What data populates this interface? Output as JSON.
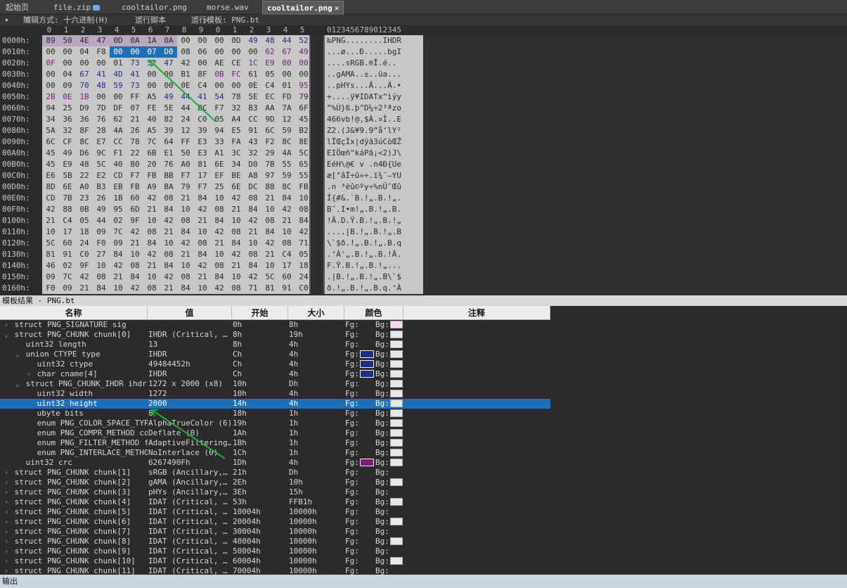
{
  "tabs": [
    {
      "label": "起始页"
    },
    {
      "label": "file.zip"
    },
    {
      "label": "cooltailor.png"
    },
    {
      "label": "morse.wav"
    },
    {
      "label": "cooltailor.png",
      "active": true
    }
  ],
  "toolbar": {
    "edit_mode": "编辑方式: 十六进制(H)",
    "run_script": "运行脚本",
    "run_template": "运行模板: PNG.bt"
  },
  "hex": {
    "col_headers": [
      "0",
      "1",
      "2",
      "3",
      "4",
      "5",
      "6",
      "7",
      "8",
      "9",
      "0",
      "1",
      "2",
      "3",
      "4",
      "5"
    ],
    "ascii_header": "0123456789012345",
    "offsets": [
      "0000h:",
      "0010h:",
      "0020h:",
      "0030h:",
      "0040h:",
      "0050h:",
      "0060h:",
      "0070h:",
      "0080h:",
      "0090h:",
      "00A0h:",
      "00B0h:",
      "00C0h:",
      "00D0h:",
      "00E0h:",
      "00F0h:",
      "0100h:",
      "0110h:",
      "0120h:",
      "0130h:",
      "0140h:",
      "0150h:",
      "0160h:"
    ],
    "rows": [
      "89 50 4E 47 0D 0A 1A 0A 00 00 00 0D 49 48 44 52",
      "00 00 04 F8 00 00 07 D0 08 06 00 00 00 62 67 49",
      "0F 00 00 00 01 73 52 47 42 00 AE CE 1C E9 00 00",
      "00 04 67 41 4D 41 00 00 B1 8F 0B FC 61 05 00 00",
      "00 09 70 48 59 73 00 00 0E C4 00 00 0E C4 01 95",
      "2B 0E 1B 00 00 FF A5 49 44 41 54 78 5E EC FD 79",
      "94 25 D9 7D DF 07 FE 5E 44 BC F7 32 B3 AA 7A 6F",
      "34 36 36 76 62 21 40 82 24 C0 05 A4 CC 9D 12 45",
      "5A 32 8F 28 4A 26 A5 39 12 39 94 E5 91 6C 59 B2",
      "6C CF 8C E7 CC 78 7C 64 FF E3 33 FA 43 F2 8C 8E",
      "45 49 D6 9C F1 22 6B E1 50 E3 A1 3C 32 29 4A 5C",
      "45 E9 48 5C 40 80 20 76 A0 81 6E 34 D0 7B 55 65",
      "E6 5B 22 E2 CD F7 FB BB F7 17 EF BE A8 97 59 55",
      "8D 6E A0 B3 EB FB A9 BA 79 F7 25 6E DC 88 8C FB",
      "CD 7B 23 26 1B 60 42 08 21 84 10 42 08 21 84 10",
      "42 88 0B 49 95 6D 21 84 10 42 08 21 84 10 42 08",
      "21 C4 05 44 02 9F 10 42 08 21 84 10 42 08 21 84",
      "10 17 18 09 7C 42 08 21 84 10 42 08 21 84 10 42",
      "5C 60 24 F0 09 21 84 10 42 08 21 84 10 42 08 71",
      "81 91 C0 27 84 10 42 08 21 84 10 42 08 21 C4 05",
      "46 02 9F 10 42 08 21 84 10 42 08 21 84 10 17 18",
      "09 7C 42 08 21 84 10 42 08 21 84 10 42 5C 60 24",
      "F0 09 21 84 10 42 08 21 84 10 42 08 71 81 91 C0"
    ],
    "ascii": [
      "‰PNG........IHDR",
      "...ø...Ð.....bgI",
      "....sRGB.®Î.é..",
      "..gAMA..±..üa...",
      "..pHYs...Ä...Ä.•",
      "+....ÿ¥IDATx^ìýy",
      "”%Ù}ß.þ^D¼÷2³ªzo",
      "466vb!@‚$À.¤Ì..E",
      "Z2.(J&¥9.9”å‘lY²",
      "lÏŒçÌx|dÿã3úCòŒŽ",
      "EIÖœñ\"káPã¡<2)J\\",
      "EéH\\@€ v .n4Ð{Ue",
      "æ[\"âÍ÷û»÷.ï¾¨—YU",
      ".n ³ëû©ºy÷%nÜˆŒû",
      "Í{#&.`B.!„.B.!„.",
      "Bˆ.I•m!„.B.!„.B.",
      "!Ä.D.Ÿ.B.!„.B.!„",
      "....|B.!„.B.!„.B",
      "\\`$ð.!„.B.!„.B.q",
      ".‘À'„.B.!„.B.!Ä.",
      "F.Ÿ.B.!„.B.!„...",
      ".|B.!„.B.!„.B\\`$",
      "ð.!„.B.!„.B.q.‘À"
    ]
  },
  "results": {
    "header": "模板结果 - PNG.bt",
    "columns": [
      "名称",
      "值",
      "开始",
      "大小",
      "颜色",
      "注释"
    ],
    "fg_label": "Fg:",
    "bg_label": "Bg:",
    "rows": [
      {
        "exp": ">",
        "indent": 0,
        "name": "struct PNG_SIGNATURE sig",
        "value": "",
        "start": "0h",
        "size": "8h",
        "fg": "",
        "bg": "#ffd7f0"
      },
      {
        "exp": "v",
        "indent": 0,
        "name": "struct PNG_CHUNK chunk[0]",
        "value": "IHDR  (Critical, …",
        "start": "8h",
        "size": "19h",
        "fg": "",
        "bg": "#e8e8e8"
      },
      {
        "exp": "",
        "indent": 1,
        "name": "uint32 length",
        "value": "13",
        "start": "8h",
        "size": "4h",
        "fg": "",
        "bg": "#e8e8e8"
      },
      {
        "exp": "v",
        "indent": 1,
        "name": "union CTYPE type",
        "value": "IHDR",
        "start": "Ch",
        "size": "4h",
        "fg": "#1d2d8c",
        "bg": "#e8e8e8"
      },
      {
        "exp": "",
        "indent": 2,
        "name": "uint32 ctype",
        "value": "49484452h",
        "start": "Ch",
        "size": "4h",
        "fg": "#1d2d8c",
        "bg": "#e8e8e8"
      },
      {
        "exp": ">",
        "indent": 2,
        "name": "char cname[4]",
        "value": "IHDR",
        "start": "Ch",
        "size": "4h",
        "fg": "#1d2d8c",
        "bg": "#e8e8e8"
      },
      {
        "exp": "v",
        "indent": 1,
        "name": "struct PNG_CHUNK_IHDR ihdr",
        "value": "1272 x 2000 (x8)",
        "start": "10h",
        "size": "Dh",
        "fg": "",
        "bg": "#e8e8e8"
      },
      {
        "exp": "",
        "indent": 2,
        "name": "uint32 width",
        "value": "1272",
        "start": "10h",
        "size": "4h",
        "fg": "",
        "bg": "#e8e8e8"
      },
      {
        "exp": "",
        "indent": 2,
        "name": "uint32 height",
        "value": "2000",
        "start": "14h",
        "size": "4h",
        "fg": "",
        "bg": "#e8e8e8",
        "selected": true
      },
      {
        "exp": "",
        "indent": 2,
        "name": "ubyte bits",
        "value": "8",
        "start": "18h",
        "size": "1h",
        "fg": "",
        "bg": "#e8e8e8"
      },
      {
        "exp": "",
        "indent": 2,
        "name": "enum PNG_COLOR_SPACE_TYP…",
        "value": "AlphaTrueColor (6)",
        "start": "19h",
        "size": "1h",
        "fg": "",
        "bg": "#e8e8e8"
      },
      {
        "exp": "",
        "indent": 2,
        "name": "enum PNG_COMPR_METHOD co…",
        "value": "Deflate (0)",
        "start": "1Ah",
        "size": "1h",
        "fg": "",
        "bg": "#e8e8e8"
      },
      {
        "exp": "",
        "indent": 2,
        "name": "enum PNG_FILTER_METHOD f…",
        "value": "AdaptiveFiltering…",
        "start": "1Bh",
        "size": "1h",
        "fg": "",
        "bg": "#e8e8e8"
      },
      {
        "exp": "",
        "indent": 2,
        "name": "enum PNG_INTERLACE_METHO…",
        "value": "NoInterlace (0)",
        "start": "1Ch",
        "size": "1h",
        "fg": "",
        "bg": "#e8e8e8"
      },
      {
        "exp": "",
        "indent": 1,
        "name": "uint32 crc",
        "value": "6267490Fh",
        "start": "1Dh",
        "size": "4h",
        "fg": "#7a1a7a",
        "bg": "#e8e8e8"
      },
      {
        "exp": ">",
        "indent": 0,
        "name": "struct PNG_CHUNK chunk[1]",
        "value": "sRGB  (Ancillary,…",
        "start": "21h",
        "size": "Dh",
        "fg": "",
        "bg": ""
      },
      {
        "exp": ">",
        "indent": 0,
        "name": "struct PNG_CHUNK chunk[2]",
        "value": "gAMA  (Ancillary,…",
        "start": "2Eh",
        "size": "10h",
        "fg": "",
        "bg": "#e8e8e8"
      },
      {
        "exp": ">",
        "indent": 0,
        "name": "struct PNG_CHUNK chunk[3]",
        "value": "pHYs  (Ancillary,…",
        "start": "3Eh",
        "size": "15h",
        "fg": "",
        "bg": ""
      },
      {
        "exp": ">",
        "indent": 0,
        "name": "struct PNG_CHUNK chunk[4]",
        "value": "IDAT  (Critical, …",
        "start": "53h",
        "size": "FFB1h",
        "fg": "",
        "bg": "#e8e8e8"
      },
      {
        "exp": ">",
        "indent": 0,
        "name": "struct PNG_CHUNK chunk[5]",
        "value": "IDAT  (Critical, …",
        "start": "10004h",
        "size": "10000h",
        "fg": "",
        "bg": ""
      },
      {
        "exp": ">",
        "indent": 0,
        "name": "struct PNG_CHUNK chunk[6]",
        "value": "IDAT  (Critical, …",
        "start": "20004h",
        "size": "10000h",
        "fg": "",
        "bg": "#e8e8e8"
      },
      {
        "exp": ">",
        "indent": 0,
        "name": "struct PNG_CHUNK chunk[7]",
        "value": "IDAT  (Critical, …",
        "start": "30004h",
        "size": "10000h",
        "fg": "",
        "bg": ""
      },
      {
        "exp": ">",
        "indent": 0,
        "name": "struct PNG_CHUNK chunk[8]",
        "value": "IDAT  (Critical, …",
        "start": "40004h",
        "size": "10000h",
        "fg": "",
        "bg": "#e8e8e8"
      },
      {
        "exp": ">",
        "indent": 0,
        "name": "struct PNG_CHUNK chunk[9]",
        "value": "IDAT  (Critical, …",
        "start": "50004h",
        "size": "10000h",
        "fg": "",
        "bg": ""
      },
      {
        "exp": ">",
        "indent": 0,
        "name": "struct PNG_CHUNK chunk[10]",
        "value": "IDAT  (Critical, …",
        "start": "60004h",
        "size": "10000h",
        "fg": "",
        "bg": "#e8e8e8"
      },
      {
        "exp": ">",
        "indent": 0,
        "name": "struct PNG_CHUNK chunk[11]",
        "value": "IDAT  (Critical, …",
        "start": "70004h",
        "size": "10000h",
        "fg": "",
        "bg": ""
      }
    ]
  },
  "output_label": "输出",
  "colors": {
    "selection": "#1e6fb8",
    "hex_bg": "#c7c7c7",
    "arrow": "#1faa3c",
    "sig_bg": "#b8a8c0",
    "chunk_type_fg": "#1d2d8c",
    "crc_fg": "#7a1a7a"
  }
}
